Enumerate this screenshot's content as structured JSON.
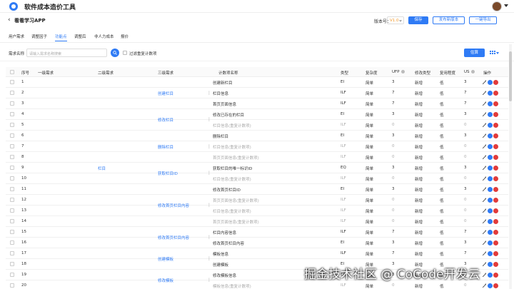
{
  "app": {
    "title": "软件成本造价工具"
  },
  "header": {
    "back_icon": "‹",
    "project_name": "看看学习APP",
    "version_label": "版本号：",
    "version_value": "V1.0",
    "save_label": "保存",
    "publish_label": "发布新版本",
    "export_label": "一键导出"
  },
  "tabs": [
    {
      "label": "用户需求"
    },
    {
      "label": "调整因子"
    },
    {
      "label": "功能点"
    },
    {
      "label": "调整后"
    },
    {
      "label": "非人力成本"
    },
    {
      "label": "报价"
    }
  ],
  "active_tab": "功能点",
  "filter": {
    "label": "需求名称",
    "placeholder": "请输入需求名称搜索",
    "checkbox_label": "过滤重复计数项",
    "estimate_label": "估算"
  },
  "table": {
    "headers": [
      "序号",
      "一级需求",
      "二级需求",
      "三级需求",
      "计数项名称",
      "类型",
      "复杂度",
      "UFP",
      "修改类型",
      "复用程度",
      "US",
      "操作"
    ],
    "merged_level2": "栏目",
    "level3": [
      {
        "label": "创建栏目"
      },
      {
        "label": "修改栏目"
      },
      {
        "label": "删除栏目"
      },
      {
        "label": "获取栏目ID"
      },
      {
        "label": "修改首页栏目内容"
      },
      {
        "label": "修改首页栏目内容"
      },
      {
        "label": "创建模板"
      },
      {
        "label": "修改模板"
      }
    ],
    "rows": [
      {
        "no": "1",
        "item": "创建新栏目",
        "type": "EI",
        "cx": "简单",
        "ufp": "3",
        "mod": "新增",
        "reuse": "低",
        "us": "3",
        "muted": false
      },
      {
        "no": "2",
        "item": "栏目信息",
        "type": "ILF",
        "cx": "简单",
        "ufp": "7",
        "mod": "新增",
        "reuse": "低",
        "us": "7",
        "muted": false
      },
      {
        "no": "3",
        "item": "首页页面信息",
        "type": "ILF",
        "cx": "简单",
        "ufp": "7",
        "mod": "新增",
        "reuse": "低",
        "us": "7",
        "muted": false
      },
      {
        "no": "4",
        "item": "修改已存在的栏目",
        "type": "EI",
        "cx": "简单",
        "ufp": "3",
        "mod": "新增",
        "reuse": "低",
        "us": "3",
        "muted": false
      },
      {
        "no": "5",
        "item": "栏目信息(重复计数项)",
        "type": "ILF",
        "cx": "简单",
        "ufp": "0",
        "mod": "新增",
        "reuse": "低",
        "us": "0",
        "muted": true
      },
      {
        "no": "6",
        "item": "删除栏目",
        "type": "EI",
        "cx": "简单",
        "ufp": "3",
        "mod": "新增",
        "reuse": "低",
        "us": "3",
        "muted": false
      },
      {
        "no": "7",
        "item": "栏目信息(重复计数项)",
        "type": "ILF",
        "cx": "简单",
        "ufp": "0",
        "mod": "新增",
        "reuse": "低",
        "us": "0",
        "muted": true
      },
      {
        "no": "8",
        "item": "首页页面信息(重复计数项)",
        "type": "ILF",
        "cx": "简单",
        "ufp": "0",
        "mod": "新增",
        "reuse": "低",
        "us": "0",
        "muted": true
      },
      {
        "no": "9",
        "item": "获取栏目的唯一标识ID",
        "type": "EQ",
        "cx": "简单",
        "ufp": "3",
        "mod": "新增",
        "reuse": "低",
        "us": "3",
        "muted": false
      },
      {
        "no": "10",
        "item": "栏目信息(重复计数项)",
        "type": "ILF",
        "cx": "简单",
        "ufp": "0",
        "mod": "新增",
        "reuse": "低",
        "us": "0",
        "muted": true
      },
      {
        "no": "11",
        "item": "修改首页栏目ID",
        "type": "EI",
        "cx": "简单",
        "ufp": "3",
        "mod": "新增",
        "reuse": "低",
        "us": "3",
        "muted": false
      },
      {
        "no": "12",
        "item": "首页页面信息(重复计数项)",
        "type": "ILF",
        "cx": "简单",
        "ufp": "0",
        "mod": "新增",
        "reuse": "低",
        "us": "0",
        "muted": true
      },
      {
        "no": "13",
        "item": "栏目信息(重复计数项)",
        "type": "ILF",
        "cx": "简单",
        "ufp": "0",
        "mod": "新增",
        "reuse": "低",
        "us": "0",
        "muted": true
      },
      {
        "no": "14",
        "item": "首页页面信息(重复计数项)",
        "type": "ILF",
        "cx": "简单",
        "ufp": "0",
        "mod": "新增",
        "reuse": "低",
        "us": "0",
        "muted": true
      },
      {
        "no": "15",
        "item": "栏目内容信息",
        "type": "ILF",
        "cx": "简单",
        "ufp": "7",
        "mod": "新增",
        "reuse": "低",
        "us": "7",
        "muted": false
      },
      {
        "no": "16",
        "item": "修改首页栏目内容",
        "type": "EI",
        "cx": "简单",
        "ufp": "3",
        "mod": "新增",
        "reuse": "低",
        "us": "3",
        "muted": false
      },
      {
        "no": "17",
        "item": "模板信息",
        "type": "ILF",
        "cx": "简单",
        "ufp": "7",
        "mod": "新增",
        "reuse": "低",
        "us": "7",
        "muted": false
      },
      {
        "no": "18",
        "item": "创建模板",
        "type": "EI",
        "cx": "简单",
        "ufp": "3",
        "mod": "新增",
        "reuse": "低",
        "us": "3",
        "muted": false
      },
      {
        "no": "19",
        "item": "修改模板信息",
        "type": "EI",
        "cx": "简单",
        "ufp": "3",
        "mod": "新增",
        "reuse": "低",
        "us": "3",
        "muted": false
      },
      {
        "no": "20",
        "item": "模板信息(重复计数项)",
        "type": "ILF",
        "cx": "简单",
        "ufp": "0",
        "mod": "新增",
        "reuse": "低",
        "us": "0",
        "muted": true
      }
    ]
  },
  "watermark": "掘金技术社区 @ CoCode开发云",
  "colors": {
    "accent": "#2f7bf5",
    "danger": "#e23b3b",
    "version": "#f29a2e"
  }
}
